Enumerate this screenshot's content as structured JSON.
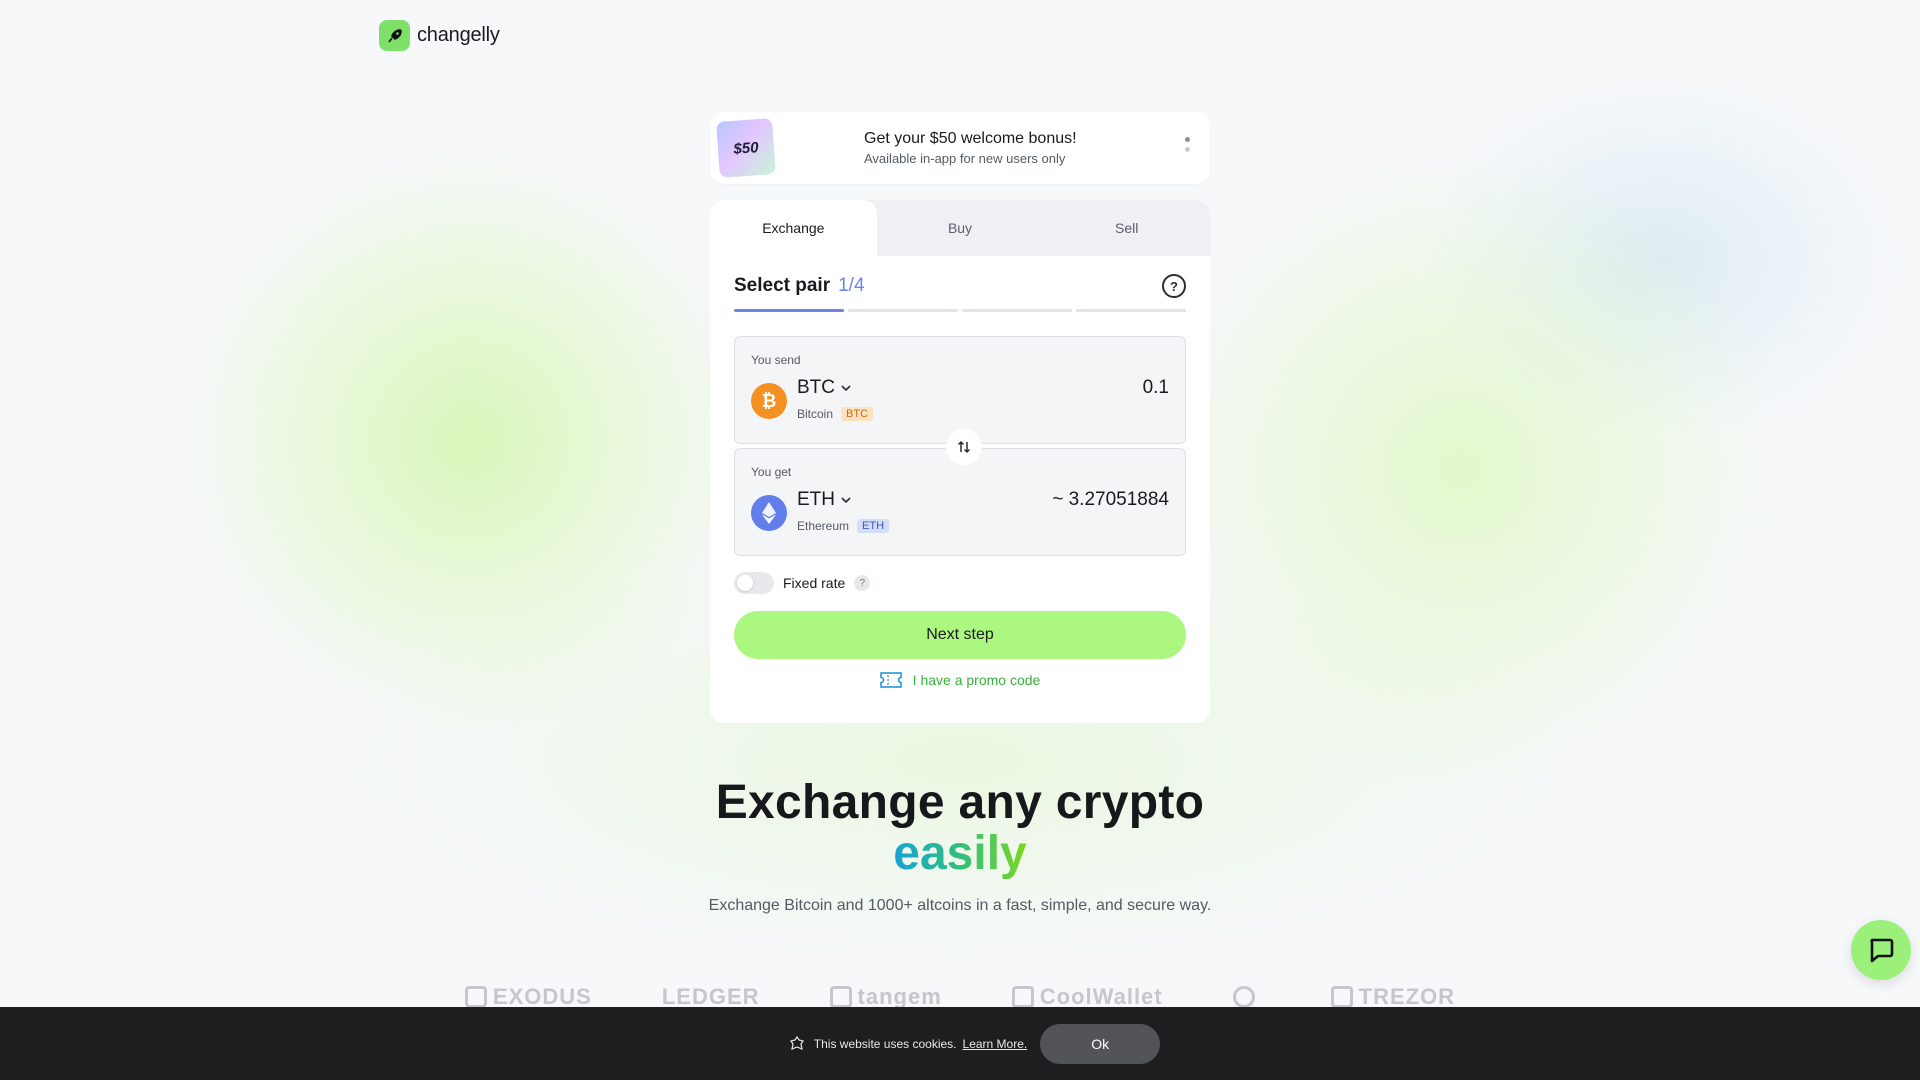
{
  "header": {
    "brand": "changelly",
    "logo_icon": "rocket-icon",
    "brand_color": "#7ee068"
  },
  "banner": {
    "thumb_label": "$50",
    "title": "Get your $50 welcome bonus!",
    "subtitle": "Available in-app for new users only"
  },
  "tabs": [
    {
      "label": "Exchange",
      "active": true
    },
    {
      "label": "Buy",
      "active": false
    },
    {
      "label": "Sell",
      "active": false
    }
  ],
  "step": {
    "title": "Select pair",
    "count": "1/4",
    "help_icon": "help-circle-icon",
    "current": 1,
    "total": 4
  },
  "send": {
    "label": "You send",
    "ticker": "BTC",
    "coin_name": "Bitcoin",
    "badge": "BTC",
    "amount": "0.1",
    "icon": "bitcoin-icon"
  },
  "get": {
    "label": "You get",
    "ticker": "ETH",
    "coin_name": "Ethereum",
    "badge": "ETH",
    "amount": "~ 3.27051884",
    "icon": "ethereum-icon"
  },
  "fixed_rate": {
    "label": "Fixed rate",
    "enabled": false,
    "help": "?"
  },
  "next_button": "Next step",
  "promo_link": "I have a promo code",
  "hero": {
    "title": "Exchange any crypto",
    "accent": "easily",
    "subtitle": "Exchange Bitcoin and 1000+ altcoins in a fast, simple, and secure way."
  },
  "partners": [
    "EXODUS",
    "LEDGER",
    "tangem",
    "CoolWallet",
    "",
    "TREZOR"
  ],
  "cookie": {
    "text": "This website uses cookies.",
    "link": "Learn More.",
    "button": "Ok"
  },
  "colors": {
    "accent_green": "#acf77f",
    "accent_blue": "#6d84e6",
    "btc": "#f49122",
    "eth": "#627eea",
    "promo_green": "#36b23a"
  }
}
